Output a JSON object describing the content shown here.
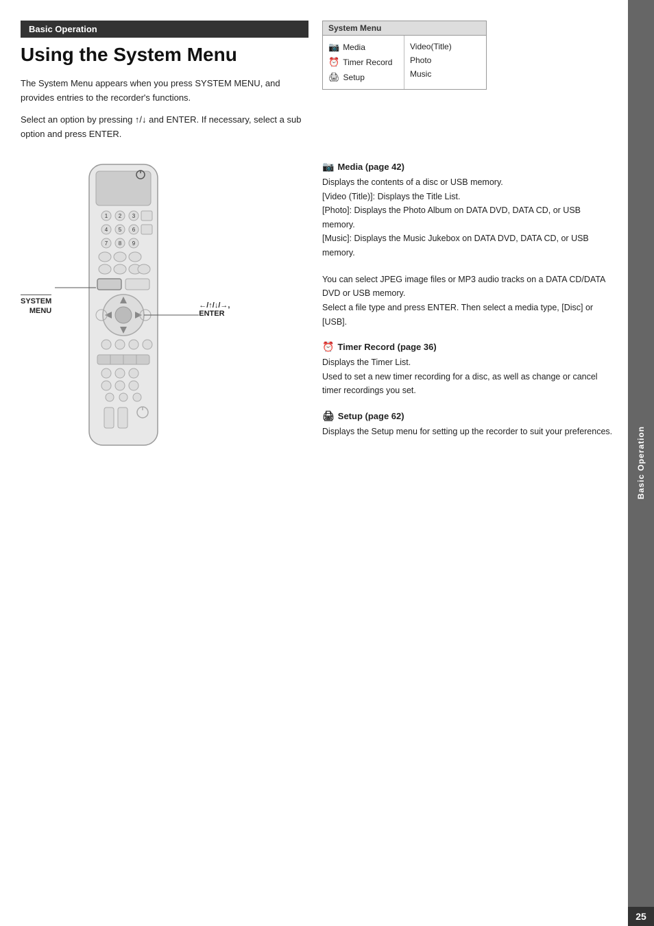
{
  "sidebar": {
    "label": "Basic Operation",
    "page_number": "25"
  },
  "header": {
    "section_label": "Basic Operation",
    "title": "Using the System Menu"
  },
  "intro": {
    "paragraph1": "The System Menu appears when you press SYSTEM MENU, and provides entries to the recorder's functions.",
    "paragraph2": "Select an option by pressing ↑/↓ and ENTER. If necessary, select a sub option and press ENTER."
  },
  "system_menu": {
    "title": "System Menu",
    "left_items": [
      {
        "icon": "📷",
        "label": "Media"
      },
      {
        "icon": "⏰",
        "label": "Timer Record"
      },
      {
        "icon": "⚙",
        "label": "Setup"
      }
    ],
    "right_items": [
      "Video(Title)",
      "Photo",
      "Music"
    ]
  },
  "remote": {
    "system_menu_label": "SYSTEM\nMENU",
    "arrow_label": "←/↑/↓/→,\nENTER"
  },
  "descriptions": [
    {
      "id": "media",
      "icon": "📷",
      "heading": "Media (page 42)",
      "body": "Displays the contents of a disc or USB memory.\n[Video (Title)]: Displays the Title List.\n[Photo]: Displays the Photo Album on DATA DVD, DATA CD, or USB memory.\n[Music]: Displays the Music Jukebox on DATA DVD, DATA CD, or USB memory."
    },
    {
      "id": "jpeg_mp3",
      "icon": "",
      "heading": "",
      "body": "You can select JPEG image files or MP3 audio tracks on a DATA CD/DATA DVD or USB memory.\nSelect a file type and press ENTER. Then select a media type, [Disc] or [USB]."
    },
    {
      "id": "timer_record",
      "icon": "⏰",
      "heading": "Timer Record (page 36)",
      "body": "Displays the Timer List.\nUsed to set a new timer recording for a disc, as well as change or cancel timer recordings you set."
    },
    {
      "id": "setup",
      "icon": "⚙",
      "heading": "Setup (page 62)",
      "body": "Displays the Setup menu for setting up the recorder to suit your preferences."
    }
  ]
}
